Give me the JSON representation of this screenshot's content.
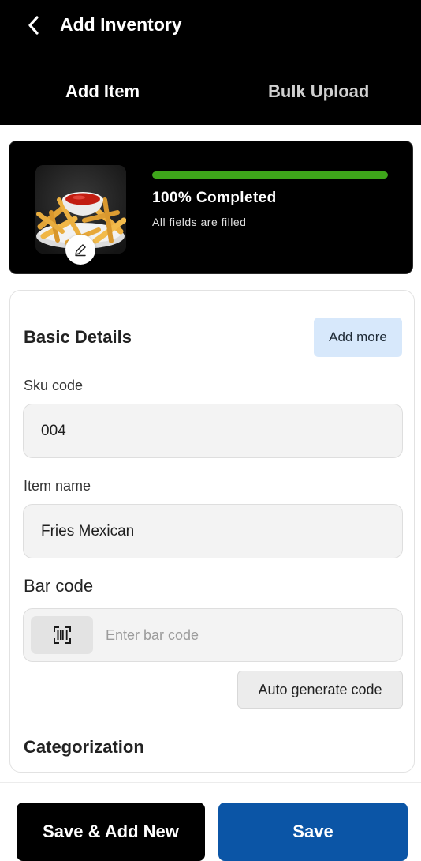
{
  "header": {
    "title": "Add Inventory",
    "back_icon": "chevron-left-icon",
    "tabs": [
      {
        "label": "Add Item",
        "active": true
      },
      {
        "label": "Bulk Upload",
        "active": false
      }
    ]
  },
  "progress": {
    "label": "100% Completed",
    "subtitle": "All fields are filled",
    "percent": 100,
    "bar_color": "#3ea51a",
    "image": "fries-with-ketchup-photo",
    "edit_icon": "pencil-icon"
  },
  "basic_details": {
    "title": "Basic Details",
    "add_more_label": "Add more",
    "sku": {
      "label": "Sku code",
      "value": "004"
    },
    "item_name": {
      "label": "Item name",
      "value": "Fries Mexican"
    },
    "barcode": {
      "label": "Bar code",
      "placeholder": "Enter bar code",
      "value": "",
      "icon": "barcode-scan-icon",
      "auto_generate_label": "Auto generate code"
    }
  },
  "categorization": {
    "title": "Categorization"
  },
  "footer": {
    "save_add_new_label": "Save & Add New",
    "save_label": "Save",
    "primary_color": "#0b55a6"
  }
}
